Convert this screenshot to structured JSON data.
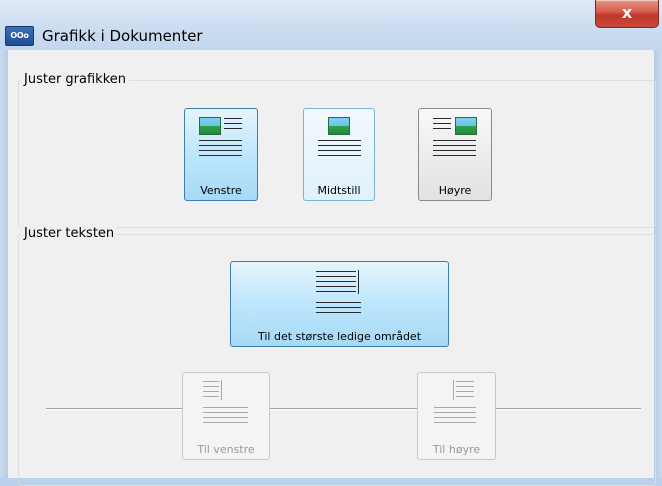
{
  "window": {
    "title": "Grafikk i Dokumenter",
    "app_icon_text": "OOo",
    "close_symbol": "x"
  },
  "groups": {
    "align_graphic": {
      "label": "Juster grafikken",
      "options": [
        {
          "label": "Venstre",
          "state": "selected"
        },
        {
          "label": "Midtstill",
          "state": "hover"
        },
        {
          "label": "Høyre",
          "state": "normal"
        }
      ]
    },
    "align_text": {
      "label": "Juster teksten",
      "main_option": {
        "label": "Til det største ledige området",
        "state": "selected"
      },
      "options": [
        {
          "label": "Til venstre",
          "state": "disabled"
        },
        {
          "label": "Til høyre",
          "state": "disabled"
        }
      ]
    }
  },
  "icons": [
    "image-left-icon",
    "image-center-icon",
    "image-right-icon",
    "text-largest-area-icon",
    "text-left-icon",
    "text-right-icon"
  ],
  "colors": {
    "selected_fill": "#bde6fd",
    "selected_border": "#3c7fb1",
    "close_button": "#c0392b",
    "titlebar": "#cfdff2"
  }
}
